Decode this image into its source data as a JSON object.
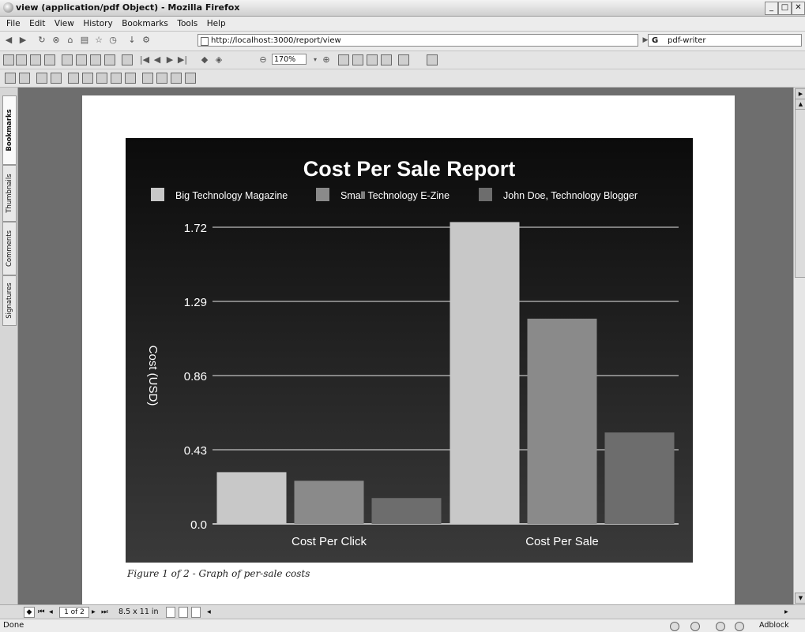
{
  "window": {
    "title": "view (application/pdf Object) - Mozilla Firefox",
    "controls": [
      "_",
      "□",
      "✕"
    ]
  },
  "menu": [
    "File",
    "Edit",
    "View",
    "History",
    "Bookmarks",
    "Tools",
    "Help"
  ],
  "navbar": {
    "url": "http://localhost:3000/report/view",
    "search_value": "pdf-writer",
    "search_engine_glyph": "G"
  },
  "pdf_toolbar": {
    "zoom_value": "170%",
    "nav_glyphs": [
      "|◀",
      "◀",
      "▶",
      "▶|"
    ]
  },
  "side_tabs": [
    "Bookmarks",
    "Thumbnails",
    "Comments",
    "Signatures"
  ],
  "chart_data": {
    "type": "bar",
    "title": "Cost Per Sale Report",
    "ylabel": "Cost (USD)",
    "xlabel": "",
    "categories": [
      "Cost Per Click",
      "Cost Per Sale"
    ],
    "series": [
      {
        "name": "Big Technology Magazine",
        "values": [
          0.3,
          1.75
        ],
        "color": "#c8c8c8"
      },
      {
        "name": "Small Technology E-Zine",
        "values": [
          0.25,
          1.19
        ],
        "color": "#8a8a8a"
      },
      {
        "name": "John Doe, Technology Blogger",
        "values": [
          0.15,
          0.53
        ],
        "color": "#6d6d6d"
      }
    ],
    "yticks": [
      "0.0",
      "0.43",
      "0.86",
      "1.29",
      "1.72"
    ],
    "ylim": [
      0,
      1.72
    ],
    "grid": true,
    "legend": "top",
    "background": "#151515"
  },
  "caption": "Figure 1 of 2 - Graph of per-sale costs",
  "page_nav": {
    "page_field": "1 of 2",
    "page_size": "8.5 x 11 in"
  },
  "status": {
    "text": "Done",
    "right_label": "Adblock"
  }
}
